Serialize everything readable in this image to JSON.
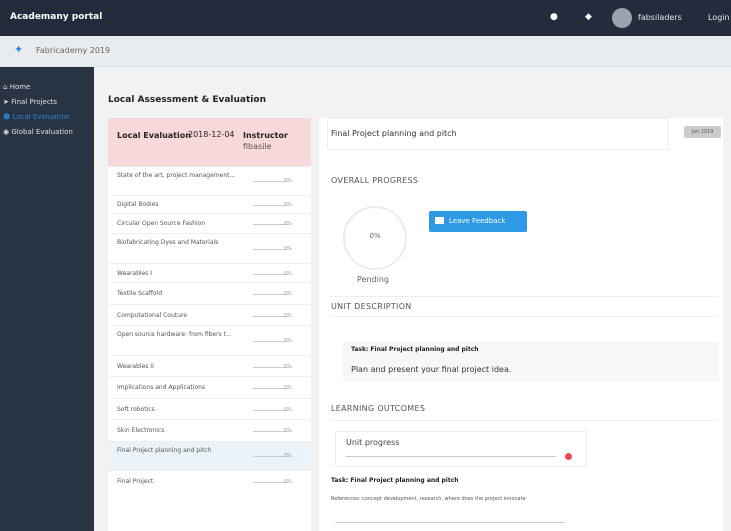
{
  "navbar": {
    "brand": "Academany portal",
    "icons": [
      "bell-icon",
      "chat-icon"
    ],
    "user": "fabsiladers",
    "login": "Login"
  },
  "breadcrumb": {
    "icon": "star-icon",
    "text": "Fabricademy 2019"
  },
  "sidebar": {
    "items": [
      {
        "icon": "home-icon",
        "label": "Home"
      },
      {
        "icon": "send-icon",
        "label": "Final Projects"
      },
      {
        "icon": "user-icon",
        "label": "Local Evaluation"
      },
      {
        "icon": "globe-icon",
        "label": "Global Evaluation"
      }
    ]
  },
  "page": {
    "title": "Local Assessment & Evaluation"
  },
  "table": {
    "header_label": "Local Evaluation",
    "header_date": "2018-12-04",
    "header_role": "Instructor",
    "header_user": "fibasile",
    "rows": [
      {
        "name": "State of the art, project management...",
        "pct": "0%"
      },
      {
        "name": "Digital Bodies",
        "pct": "0%"
      },
      {
        "name": "Circular Open Source Fashion",
        "pct": "0%"
      },
      {
        "name": "Biofabricating Dyes and Materials",
        "pct": "0%"
      },
      {
        "name": "Wearables I",
        "pct": "0%"
      },
      {
        "name": "Textile Scaffold",
        "pct": "0%"
      },
      {
        "name": "Computational Couture",
        "pct": "0%"
      },
      {
        "name": "Open source hardware: from fibers t...",
        "pct": "0%"
      },
      {
        "name": "Wearables II",
        "pct": "0%"
      },
      {
        "name": "Implications and Applications",
        "pct": "0%"
      },
      {
        "name": "Soft robotics",
        "pct": "0%"
      },
      {
        "name": "Skin Electronics",
        "pct": "0%"
      },
      {
        "name": "Final Project planning and pitch",
        "pct": "0%"
      },
      {
        "name": "Final Project",
        "pct": "0%"
      }
    ]
  },
  "unit": {
    "title": "Final Project planning and pitch",
    "badge": "Jan 2019",
    "overall_progress_heading": "OVERALL PROGRESS",
    "ring_value": "0%",
    "status": "Pending",
    "feedback_button": "Leave Feedback",
    "description_heading": "UNIT DESCRIPTION",
    "task_title": "Task: Final Project planning and pitch",
    "task_text": "Plan and present your final project idea.",
    "learning_outcomes_heading": "LEARNING OUTCOMES",
    "unit_progress_label": "Unit progress",
    "task_title_2": "Task: Final Project planning and pitch",
    "references": "References: concept development, research, where does the project innovate"
  }
}
